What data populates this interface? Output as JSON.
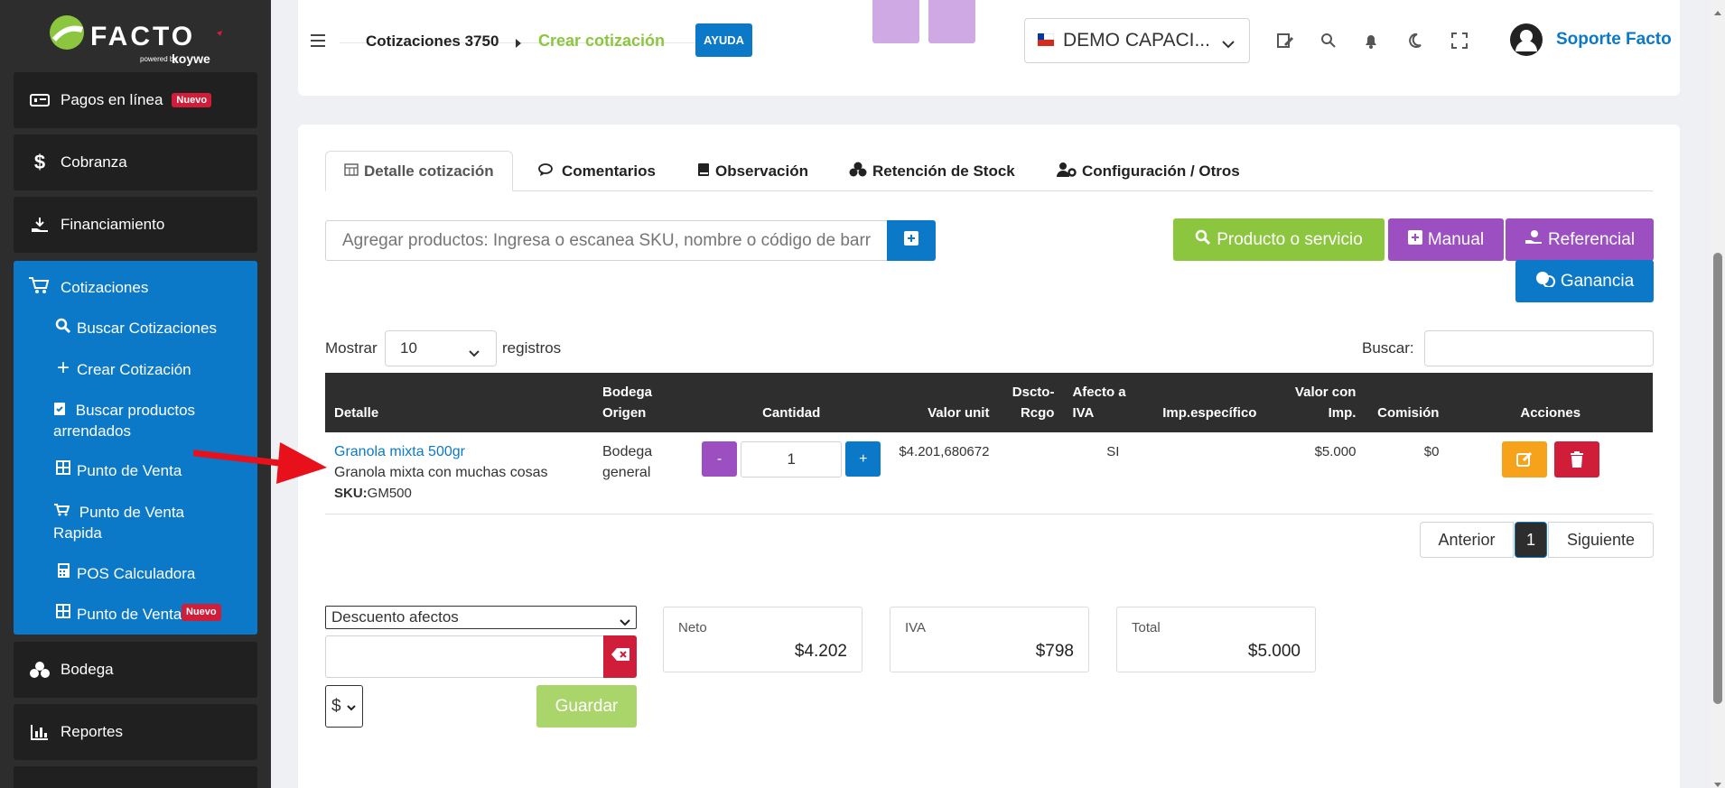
{
  "brand": {
    "name": "FACTO",
    "powered": "powered by",
    "company": "koywe"
  },
  "sidebar": {
    "items": [
      {
        "label": "Pagos en línea",
        "badge": "Nuevo",
        "icon": "money-bill-icon"
      },
      {
        "label": "Cobranza",
        "icon": "dollar-icon"
      },
      {
        "label": "Financiamiento",
        "icon": "hand-money-icon"
      },
      {
        "label": "Cotizaciones",
        "icon": "cart-icon"
      },
      {
        "label": "Bodega",
        "icon": "boxes-icon"
      },
      {
        "label": "Reportes",
        "icon": "chart-bar-icon"
      }
    ],
    "sub": [
      {
        "label": "Buscar Cotizaciones",
        "icon": "search-icon"
      },
      {
        "label": "Crear Cotización",
        "icon": "plus-icon"
      },
      {
        "label": "Buscar productos arrendados",
        "icon": "clipboard-icon"
      },
      {
        "label": "Punto de Venta",
        "icon": "grid-icon"
      },
      {
        "label": "Punto de Venta Rapida",
        "icon": "cart-icon"
      },
      {
        "label": "POS Calculadora",
        "icon": "calculator-icon"
      },
      {
        "label": "Punto de Venta",
        "icon": "grid-icon",
        "badge": "Nuevo"
      }
    ]
  },
  "header": {
    "crumb1": "Cotizaciones 3750",
    "crumb2": "Crear cotización",
    "help": "AYUDA",
    "company": "DEMO CAPACI...",
    "user": "Soporte Facto"
  },
  "tabs": [
    "Detalle cotización",
    "Comentarios",
    "Observación",
    "Retención de Stock",
    "Configuración / Otros"
  ],
  "search": {
    "placeholder": "Agregar productos: Ingresa o escanea SKU, nombre o código de barras y presiona enter"
  },
  "buttons": {
    "producto": "Producto o servicio",
    "manual": "Manual",
    "referencial": "Referencial",
    "ganancia": "Ganancia"
  },
  "table": {
    "show": "Mostrar",
    "show_value": "10",
    "records": "registros",
    "search_label": "Buscar:",
    "headers": {
      "detalle": "Detalle",
      "bodega1": "Bodega",
      "bodega2": "Origen",
      "cantidad": "Cantidad",
      "valor": "Valor unit",
      "dscto1": "Dscto-",
      "dscto2": "Rcgo",
      "afecto1": "Afecto a",
      "afecto2": "IVA",
      "imp": "Imp.específico",
      "vci1": "Valor con",
      "vci2": "Imp.",
      "comision": "Comisión",
      "acciones": "Acciones"
    },
    "row": {
      "name": "Granola mixta 500gr",
      "desc": "Granola mixta con muchas cosas",
      "sku_label": "SKU:",
      "sku": "GM500",
      "bodega1": "Bodega",
      "bodega2": "general",
      "qty_minus": "-",
      "qty": "1",
      "qty_plus": "+",
      "valor": "$4.201,680672",
      "afecto": "SI",
      "vci": "$5.000",
      "comision": "$0"
    }
  },
  "pagination": {
    "prev": "Anterior",
    "page": "1",
    "next": "Siguiente"
  },
  "discount": {
    "select": "Descuento afectos",
    "currency": "$",
    "save": "Guardar"
  },
  "summary": {
    "neto_label": "Neto",
    "neto": "$4.202",
    "iva_label": "IVA",
    "iva": "$798",
    "total_label": "Total",
    "total": "$5.000"
  },
  "colors": {
    "green": "#8cc63f",
    "purple": "#9b4fc0",
    "blue": "#0b79c8",
    "red": "#d01e3a",
    "orange": "#f7a21b",
    "dark": "#2d2d2d"
  }
}
